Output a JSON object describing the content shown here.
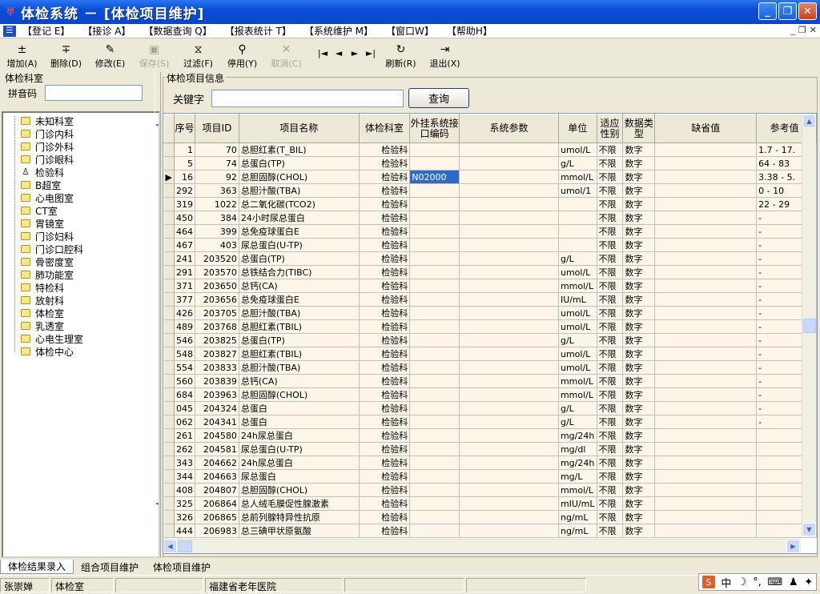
{
  "window": {
    "title": "体检系统 － [体检项目维护]"
  },
  "menu": [
    "【登记 E】",
    "【接诊 A】",
    "【数据查询 Q】",
    "【报表统计 T】",
    "【系统维护 M】",
    "【窗口W】",
    "【帮助H】"
  ],
  "toolbar": [
    {
      "label": "增加(A)",
      "icon": "add-icon",
      "glyph": "±",
      "disabled": false
    },
    {
      "label": "删除(D)",
      "icon": "delete-icon",
      "glyph": "∓",
      "disabled": false
    },
    {
      "label": "修改(E)",
      "icon": "edit-icon",
      "glyph": "✎",
      "disabled": false
    },
    {
      "label": "保存(S)",
      "icon": "save-icon",
      "glyph": "▣",
      "disabled": true
    },
    {
      "label": "过滤(F)",
      "icon": "filter-icon",
      "glyph": "⧖",
      "disabled": false
    },
    {
      "label": "停用(Y)",
      "icon": "disable-icon",
      "glyph": "⚲",
      "disabled": false
    },
    {
      "label": "取消(C)",
      "icon": "cancel-icon",
      "glyph": "✕",
      "disabled": true
    },
    {
      "label": "刷新(R)",
      "icon": "refresh-icon",
      "glyph": "↻",
      "disabled": false
    },
    {
      "label": "退出(X)",
      "icon": "exit-icon",
      "glyph": "⇥",
      "disabled": false
    }
  ],
  "nav": [
    "|◄",
    "◄",
    "►",
    "►|"
  ],
  "left": {
    "title": "体检科室",
    "search_label": "拼音码",
    "search_value": "",
    "departments": [
      "未知科室",
      "门诊内科",
      "门诊外科",
      "门诊眼科",
      "检验科",
      "B超室",
      "心电图室",
      "CT室",
      "胃镜室",
      "门诊妇科",
      "门诊口腔科",
      "骨密度室",
      "肺功能室",
      "特检科",
      "放射科",
      "体检室",
      "乳透室",
      "心电生理室",
      "体检中心"
    ]
  },
  "main": {
    "title": "体检项目信息",
    "keyword_label": "关键字",
    "keyword_value": "",
    "query_label": "查询",
    "headers": [
      "序号",
      "项目ID",
      "项目名称",
      "体检科室",
      "外挂系统接口编码",
      "系统参数",
      "单位",
      "适应性别",
      "数据类型",
      "缺省值",
      "参考值"
    ],
    "rows": [
      [
        "1",
        "70",
        "总胆红素(T_BIL)",
        "检验科",
        "",
        "",
        "umol/L",
        "不限",
        "数字",
        "",
        "1.7 - 17."
      ],
      [
        "5",
        "74",
        "总蛋白(TP)",
        "检验科",
        "",
        "",
        "g/L",
        "不限",
        "数字",
        "",
        "64 - 83"
      ],
      [
        "16",
        "92",
        "总胆固醇(CHOL)",
        "检验科",
        "N02000",
        "",
        "mmol/L",
        "不限",
        "数字",
        "",
        "3.38 - 5."
      ],
      [
        "292",
        "363",
        "总胆汁酸(TBA)",
        "检验科",
        "",
        "",
        "umol/1",
        "不限",
        "数字",
        "",
        "0 - 10"
      ],
      [
        "319",
        "1022",
        "总二氧化碳(TCO2)",
        "检验科",
        "",
        "",
        "",
        "不限",
        "数字",
        "",
        "22 - 29"
      ],
      [
        "450",
        "384",
        "24小时尿总蛋白",
        "检验科",
        "",
        "",
        "",
        "不限",
        "数字",
        "",
        "-"
      ],
      [
        "464",
        "399",
        "总免疫球蛋白E",
        "检验科",
        "",
        "",
        "",
        "不限",
        "数字",
        "",
        "-"
      ],
      [
        "467",
        "403",
        "尿总蛋白(U-TP)",
        "检验科",
        "",
        "",
        "",
        "不限",
        "数字",
        "",
        "-"
      ],
      [
        "241",
        "203520",
        "总蛋白(TP)",
        "检验科",
        "",
        "",
        "g/L",
        "不限",
        "数字",
        "",
        "-"
      ],
      [
        "291",
        "203570",
        "总铁结合力(TIBC)",
        "检验科",
        "",
        "",
        "umol/L",
        "不限",
        "数字",
        "",
        "-"
      ],
      [
        "371",
        "203650",
        "总钙(CA)",
        "检验科",
        "",
        "",
        "mmol/L",
        "不限",
        "数字",
        "",
        "-"
      ],
      [
        "377",
        "203656",
        "总免疫球蛋白E",
        "检验科",
        "",
        "",
        "IU/mL",
        "不限",
        "数字",
        "",
        "-"
      ],
      [
        "426",
        "203705",
        "总胆汁酸(TBA)",
        "检验科",
        "",
        "",
        "umol/L",
        "不限",
        "数字",
        "",
        "-"
      ],
      [
        "489",
        "203768",
        "总胆红素(TBIL)",
        "检验科",
        "",
        "",
        "umol/L",
        "不限",
        "数字",
        "",
        "-"
      ],
      [
        "546",
        "203825",
        "总蛋白(TP)",
        "检验科",
        "",
        "",
        "g/L",
        "不限",
        "数字",
        "",
        "-"
      ],
      [
        "548",
        "203827",
        "总胆红素(TBIL)",
        "检验科",
        "",
        "",
        "umol/L",
        "不限",
        "数字",
        "",
        "-"
      ],
      [
        "554",
        "203833",
        "总胆汁酸(TBA)",
        "检验科",
        "",
        "",
        "umol/L",
        "不限",
        "数字",
        "",
        "-"
      ],
      [
        "560",
        "203839",
        "总钙(CA)",
        "检验科",
        "",
        "",
        "mmol/L",
        "不限",
        "数字",
        "",
        "-"
      ],
      [
        "684",
        "203963",
        "总胆固醇(CHOL)",
        "检验科",
        "",
        "",
        "mmol/L",
        "不限",
        "数字",
        "",
        "-"
      ],
      [
        "045",
        "204324",
        "总蛋白",
        "检验科",
        "",
        "",
        "g/L",
        "不限",
        "数字",
        "",
        "-"
      ],
      [
        "062",
        "204341",
        "总蛋白",
        "检验科",
        "",
        "",
        "g/L",
        "不限",
        "数字",
        "",
        "-"
      ],
      [
        "261",
        "204580",
        "24h尿总蛋白",
        "检验科",
        "",
        "",
        "mg/24h",
        "不限",
        "数字",
        "",
        ""
      ],
      [
        "262",
        "204581",
        "尿总蛋白(U-TP)",
        "检验科",
        "",
        "",
        "mg/dl",
        "不限",
        "数字",
        "",
        ""
      ],
      [
        "343",
        "204662",
        "24h尿总蛋白",
        "检验科",
        "",
        "",
        "mg/24h",
        "不限",
        "数字",
        "",
        ""
      ],
      [
        "344",
        "204663",
        "尿总蛋白",
        "检验科",
        "",
        "",
        "mg/L",
        "不限",
        "数字",
        "",
        ""
      ],
      [
        "408",
        "204807",
        "总胆固醇(CHOL)",
        "检验科",
        "",
        "",
        "mmol/L",
        "不限",
        "数字",
        "",
        ""
      ],
      [
        "325",
        "206864",
        "总人绒毛膜促性腺激素",
        "检验科",
        "",
        "",
        "mIU/mL",
        "不限",
        "数字",
        "",
        ""
      ],
      [
        "326",
        "206865",
        "总前列腺特异性抗原",
        "检验科",
        "",
        "",
        "ng/mL",
        "不限",
        "数字",
        "",
        ""
      ],
      [
        "444",
        "206983",
        "总三碘甲状原氨酸",
        "检验科",
        "",
        "",
        "ng/mL",
        "不限",
        "数字",
        "",
        ""
      ]
    ]
  },
  "tabs": [
    "体检结果录入",
    "组合项目维护",
    "体检项目维护"
  ],
  "status": [
    "张崇婵",
    "体检室",
    "",
    "福建省老年医院",
    "",
    ""
  ],
  "ime": [
    "S",
    "中",
    "☽",
    "°,",
    "⌨",
    "♟",
    "✦"
  ]
}
